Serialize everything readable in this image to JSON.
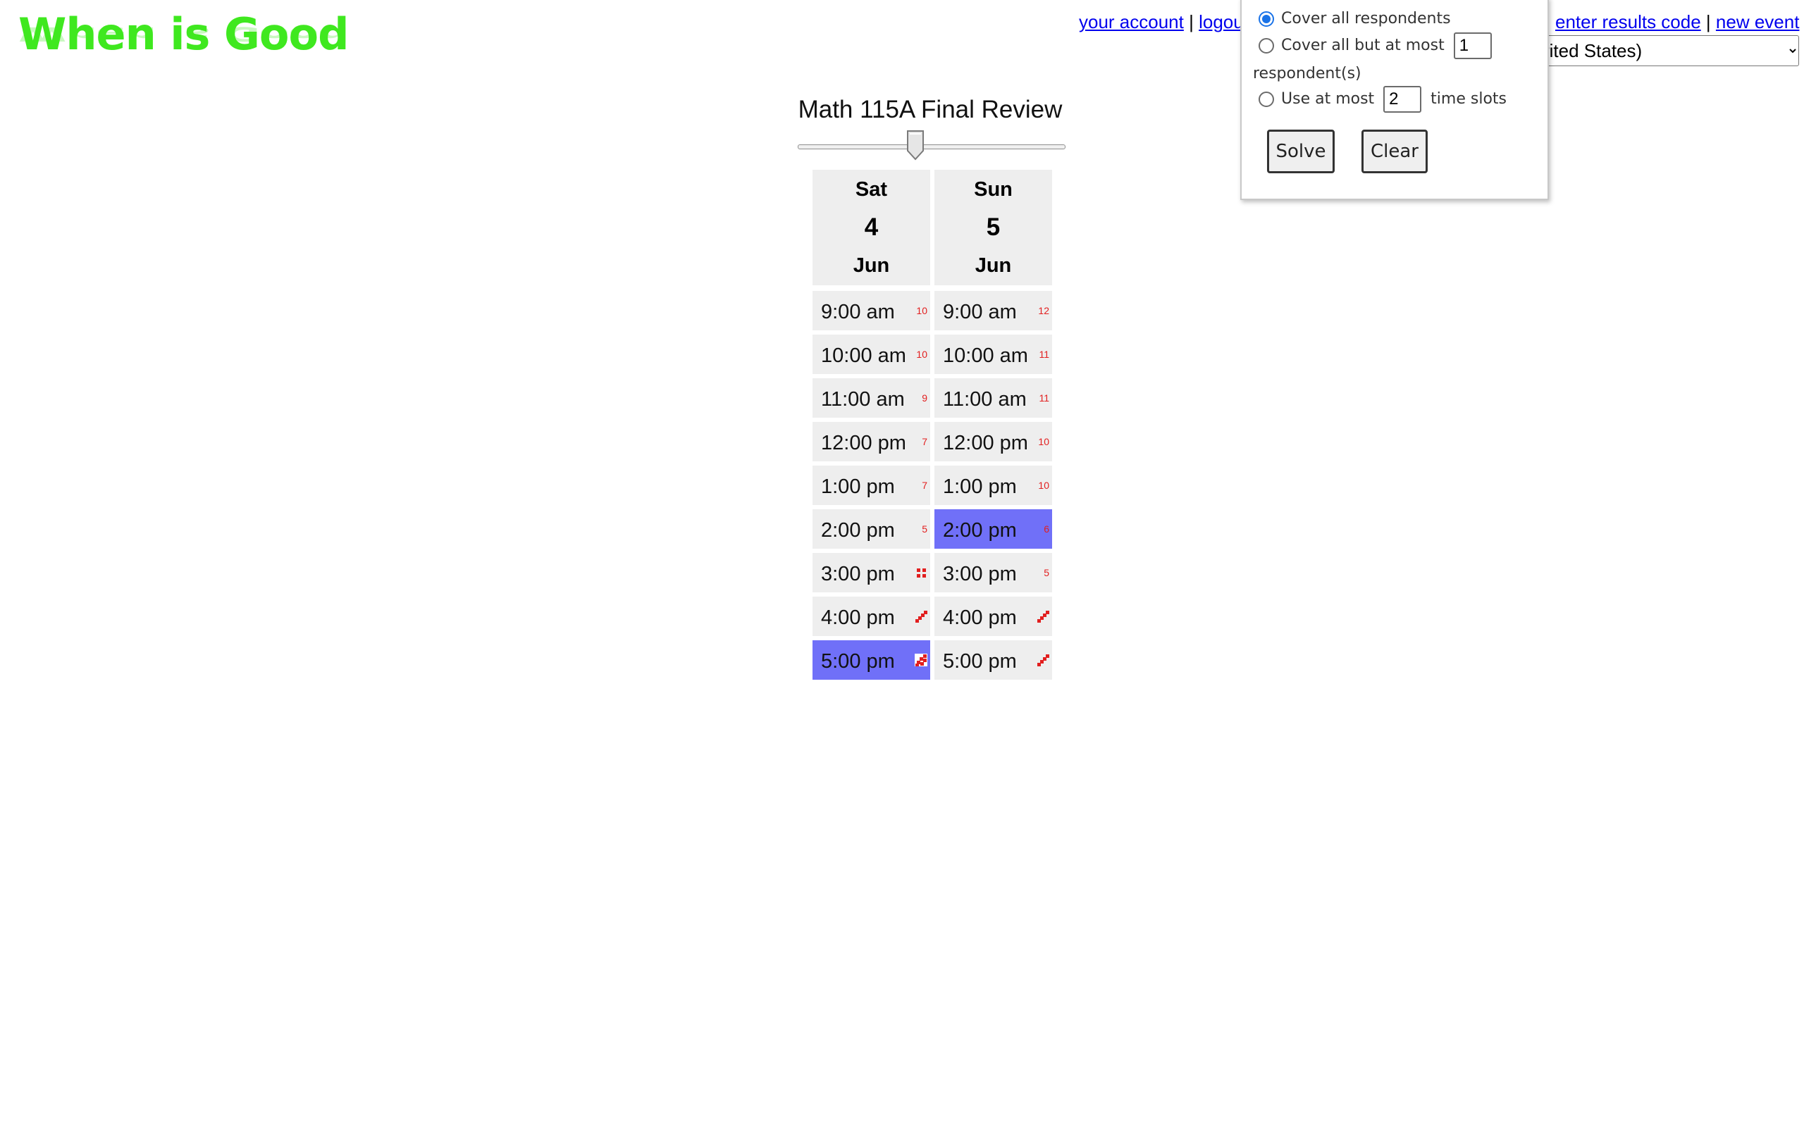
{
  "logo": {
    "text": "When is Good"
  },
  "top_links_left": {
    "your_account": "your account",
    "sep": "|",
    "logout": "logou"
  },
  "top_links_right": {
    "sep1": "|",
    "enter_results_code": "enter results code",
    "sep2": "|",
    "new_event": "new event"
  },
  "timezone": {
    "selected": "rited States)"
  },
  "solver": {
    "option1_label": "Cover all respondents",
    "option2_label": "Cover all but at most",
    "option2_value": "1",
    "option2_suffix": "respondent(s)",
    "option3_label": "Use at most",
    "option3_value": "2",
    "option3_suffix": "time slots",
    "selected_option": 1,
    "solve_label": "Solve",
    "clear_label": "Clear"
  },
  "event": {
    "title": "Math 115A Final Review"
  },
  "slider": {
    "value_fraction": 0.43
  },
  "days": [
    {
      "dow": "Sat",
      "dom": "4",
      "mon": "Jun",
      "slots": [
        {
          "time": "9:00 am",
          "count": "10",
          "selected": false
        },
        {
          "time": "10:00 am",
          "count": "10",
          "selected": false
        },
        {
          "time": "11:00 am",
          "count": "9",
          "selected": false
        },
        {
          "time": "12:00 pm",
          "count": "7",
          "selected": false
        },
        {
          "time": "1:00 pm",
          "count": "7",
          "selected": false
        },
        {
          "time": "2:00 pm",
          "count": "5",
          "selected": false
        },
        {
          "time": "3:00 pm",
          "count": "",
          "marker": "four-dots",
          "selected": false
        },
        {
          "time": "4:00 pm",
          "count": "",
          "marker": "diagonal-dots",
          "selected": false
        },
        {
          "time": "5:00 pm",
          "count": "",
          "marker": "checker-dots",
          "selected": true
        }
      ]
    },
    {
      "dow": "Sun",
      "dom": "5",
      "mon": "Jun",
      "slots": [
        {
          "time": "9:00 am",
          "count": "12",
          "selected": false
        },
        {
          "time": "10:00 am",
          "count": "11",
          "selected": false
        },
        {
          "time": "11:00 am",
          "count": "11",
          "selected": false
        },
        {
          "time": "12:00 pm",
          "count": "10",
          "selected": false
        },
        {
          "time": "1:00 pm",
          "count": "10",
          "selected": false
        },
        {
          "time": "2:00 pm",
          "count": "6",
          "selected": true
        },
        {
          "time": "3:00 pm",
          "count": "5",
          "selected": false
        },
        {
          "time": "4:00 pm",
          "count": "",
          "marker": "diagonal-dots",
          "selected": false
        },
        {
          "time": "5:00 pm",
          "count": "",
          "marker": "diagonal-dots",
          "selected": false
        }
      ]
    }
  ],
  "colors": {
    "logo": "#3fe81f",
    "selected_slot": "#7070f8",
    "count_text": "#e21f1f",
    "cell_bg": "#eeeeee",
    "link": "#0000ee"
  }
}
